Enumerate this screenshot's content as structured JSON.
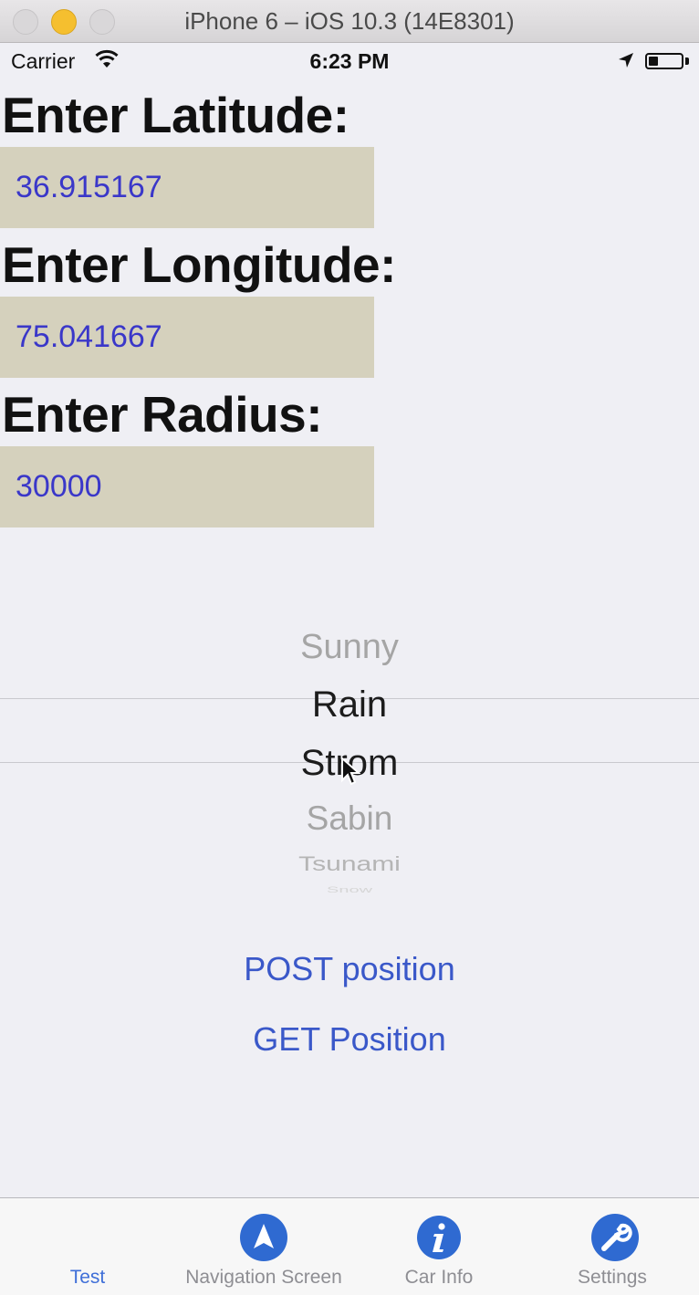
{
  "window": {
    "title": "iPhone 6 – iOS 10.3 (14E8301)"
  },
  "status_bar": {
    "carrier": "Carrier",
    "time": "6:23 PM"
  },
  "form": {
    "latitude_label": "Enter Latitude:",
    "latitude_value": "36.915167",
    "longitude_label": "Enter Longitude:",
    "longitude_value": "75.041667",
    "radius_label": "Enter Radius:",
    "radius_value": "30000"
  },
  "picker": {
    "items": [
      "Sunny",
      "Rain",
      "Strom",
      "Sabin",
      "Tsunami",
      "Snow"
    ],
    "selected": "Rain"
  },
  "buttons": {
    "post": "POST position",
    "get": "GET Position"
  },
  "tabs": [
    {
      "label": "Test",
      "icon": "none",
      "active": true
    },
    {
      "label": "Navigation Screen",
      "icon": "navigation-arrow-icon"
    },
    {
      "label": "Car Info",
      "icon": "info-icon"
    },
    {
      "label": "Settings",
      "icon": "wrench-icon"
    }
  ],
  "colors": {
    "field_bg": "#d5d1bd",
    "field_text": "#3a37c9",
    "link": "#3a58c9",
    "tab_icon": "#2f6ad1"
  }
}
